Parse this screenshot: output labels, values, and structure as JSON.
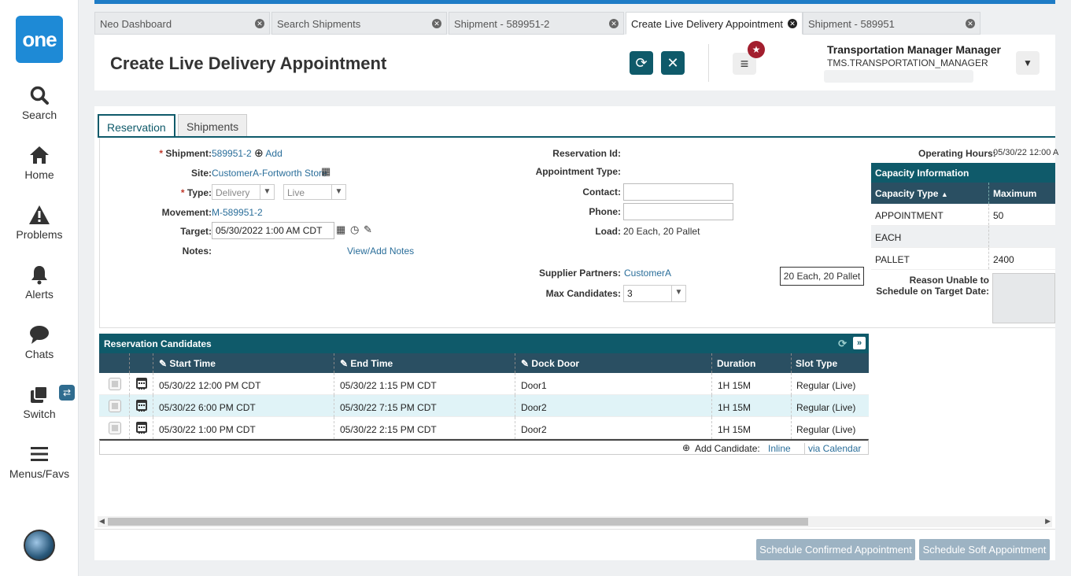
{
  "app": {
    "logo_text": "one",
    "accent_color": "#0f5a6a",
    "brand_color": "#1e8ad6"
  },
  "sidebar": {
    "items": [
      {
        "label": "Search",
        "icon": "search-icon"
      },
      {
        "label": "Home",
        "icon": "home-icon"
      },
      {
        "label": "Problems",
        "icon": "warning-icon"
      },
      {
        "label": "Alerts",
        "icon": "bell-icon"
      },
      {
        "label": "Chats",
        "icon": "chat-icon"
      },
      {
        "label": "Switch",
        "icon": "switch-icon"
      },
      {
        "label": "Menus/Favs",
        "icon": "menu-icon"
      }
    ],
    "switch_badge": "⇄"
  },
  "tabs": [
    {
      "label": "Neo Dashboard"
    },
    {
      "label": "Search Shipments"
    },
    {
      "label": "Shipment - 589951-2"
    },
    {
      "label": "Create Live Delivery Appointment"
    },
    {
      "label": "Shipment - 589951"
    }
  ],
  "header": {
    "title": "Create Live Delivery Appointment",
    "user_name": "Transportation Manager Manager",
    "user_role": "TMS.TRANSPORTATION_MANAGER"
  },
  "subtabs": [
    {
      "label": "Reservation"
    },
    {
      "label": "Shipments"
    }
  ],
  "form": {
    "shipment_label": "Shipment:",
    "shipment_value": "589951-2",
    "add_label": "Add",
    "site_label": "Site:",
    "site_value": "CustomerA-Fortworth Store",
    "type_label": "Type:",
    "type_value1": "Delivery",
    "type_value2": "Live",
    "movement_label": "Movement:",
    "movement_value": "M-589951-2",
    "target_label": "Target:",
    "target_value": "05/30/2022 1:00 AM CDT",
    "notes_label": "Notes:",
    "notes_link": "View/Add Notes",
    "reservation_id_label": "Reservation Id:",
    "appointment_type_label": "Appointment Type:",
    "contact_label": "Contact:",
    "contact_value": "",
    "phone_label": "Phone:",
    "phone_value": "",
    "load_label": "Load:",
    "load_value": "20 Each, 20 Pallet",
    "load_tooltip": "20 Each, 20 Pallet",
    "supplier_label": "Supplier Partners:",
    "supplier_value": "CustomerA",
    "max_candidates_label": "Max Candidates:",
    "max_candidates_value": "3",
    "operating_hours_label": "Operating Hours:",
    "operating_hours_value": "05/30/22 12:00 A"
  },
  "capacity": {
    "title": "Capacity Information",
    "col1": "Capacity Type",
    "col2": "Maximum",
    "rows": [
      {
        "type": "APPOINTMENT",
        "max": "50"
      },
      {
        "type": "EACH",
        "max": ""
      },
      {
        "type": "PALLET",
        "max": "2400"
      }
    ],
    "reason_label": "Reason Unable to Schedule on Target Date:"
  },
  "candidates": {
    "title": "Reservation Candidates",
    "columns": [
      "Start Time",
      "End Time",
      "Dock Door",
      "Duration",
      "Slot Type"
    ],
    "rows": [
      {
        "start": "05/30/22 12:00 PM CDT",
        "end": "05/30/22 1:15 PM CDT",
        "door": "Door1",
        "duration": "1H 15M",
        "slot": "Regular (Live)"
      },
      {
        "start": "05/30/22 6:00 PM CDT",
        "end": "05/30/22 7:15 PM CDT",
        "door": "Door2",
        "duration": "1H 15M",
        "slot": "Regular (Live)"
      },
      {
        "start": "05/30/22 1:00 PM CDT",
        "end": "05/30/22 2:15 PM CDT",
        "door": "Door2",
        "duration": "1H 15M",
        "slot": "Regular (Live)"
      }
    ],
    "add_candidate_label": "Add Candidate:",
    "inline_link": "Inline",
    "calendar_link": "via Calendar"
  },
  "actions": {
    "confirmed": "Schedule Confirmed Appointment",
    "soft": "Schedule Soft Appointment"
  }
}
